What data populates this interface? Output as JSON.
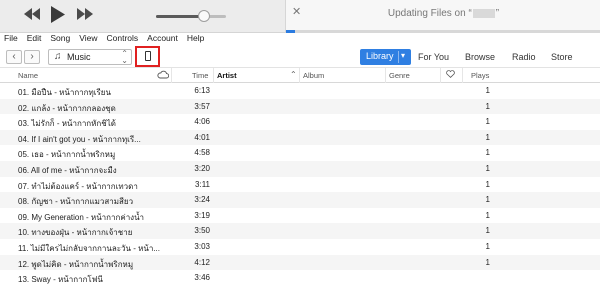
{
  "player": {
    "volume_level": 0.68,
    "status_prefix": "Updating Files on “",
    "status_suffix": "”",
    "sync_progress": 0.03
  },
  "menu": [
    "File",
    "Edit",
    "Song",
    "View",
    "Controls",
    "Account",
    "Help"
  ],
  "toolbar": {
    "back_symbol": "‹",
    "forward_symbol": "›",
    "source_icon": "♫",
    "source_label": "Music",
    "library_label": "Library",
    "tabs": [
      "For You",
      "Browse",
      "Radio",
      "Store"
    ]
  },
  "table": {
    "headers": {
      "name": "Name",
      "time": "Time",
      "artist": "Artist",
      "album": "Album",
      "genre": "Genre",
      "plays": "Plays"
    },
    "rows": [
      {
        "name": "01. มือปืน - หน้ากากทุเรียน",
        "time": "6:13",
        "plays": "1"
      },
      {
        "name": "02. แกล้ง - หน้ากากกลองชุด",
        "time": "3:57",
        "plays": "1"
      },
      {
        "name": "03. ไม่รักก็ - หน้ากากหักชิได้",
        "time": "4:06",
        "plays": "1"
      },
      {
        "name": "04. If I ain't got you - หน้ากากทุเรี...",
        "time": "4:01",
        "plays": "1"
      },
      {
        "name": "05. เธอ - หน้ากากน้ำพริกหมู",
        "time": "4:58",
        "plays": "1"
      },
      {
        "name": "06. All of me - หน้ากากจะมืง",
        "time": "3:20",
        "plays": "1"
      },
      {
        "name": "07. ทำไม่ต้องแคร์ - หน้ากากเทวดา",
        "time": "3:11",
        "plays": "1"
      },
      {
        "name": "08. กัญชา - หน้ากากแมวสามสียว",
        "time": "3:24",
        "plays": "1"
      },
      {
        "name": "09. My Generation - หน้ากากค่างน้ำ",
        "time": "3:19",
        "plays": "1"
      },
      {
        "name": "10. ทางของฝุ่น - หน้ากากเจ้าชาย",
        "time": "3:50",
        "plays": "1"
      },
      {
        "name": "11. ไม่มีใครไม่กลับจากกานละวัน - หน้า...",
        "time": "3:03",
        "plays": "1"
      },
      {
        "name": "12. พูดไม่คิด - หน้ากากน้ำพริกหมู",
        "time": "4:12",
        "plays": "1"
      },
      {
        "name": "13. Sway - หน้ากากโฟนี",
        "time": "3:46",
        "plays": ""
      }
    ]
  },
  "colors": {
    "accent": "#2f7fe2",
    "highlight": "#e02020"
  }
}
